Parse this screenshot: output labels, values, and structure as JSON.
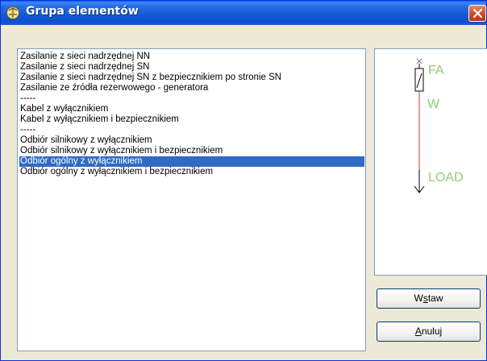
{
  "window": {
    "title": "Grupa elementów",
    "close_icon": "close-icon"
  },
  "list": {
    "items": [
      "Zasilanie z sieci nadrzędnej NN",
      "Zasilanie z sieci nadrzędnej SN",
      "Zasilanie z sieci nadrzędnej SN z bezpiecznikiem po stronie SN",
      "Zasilanie ze źródła rezerwowego - generatora",
      "-----",
      "Kabel z wyłącznikiem",
      "Kabel z wyłącznikiem i bezpiecznikiem",
      "-----",
      "Odbiór silnikowy z wyłącznikiem",
      "Odbiór silnikowy z wyłącznikiem i bezpiecznikiem",
      "Odbiór ogólny z wyłącznikiem",
      "Odbiór ogólny z wyłącznikiem i bezpiecznikiem"
    ],
    "selected_index": 10,
    "selection_color": "#316ac5"
  },
  "preview": {
    "labels": {
      "top": "FA",
      "middle": "W",
      "bottom": "LOAD"
    },
    "label_color": "#8ecf72",
    "line_color": "#c0392b"
  },
  "buttons": {
    "insert": {
      "pre": "W",
      "accel": "s",
      "post": "taw"
    },
    "cancel": {
      "pre": "",
      "accel": "A",
      "post": "nuluj"
    }
  }
}
